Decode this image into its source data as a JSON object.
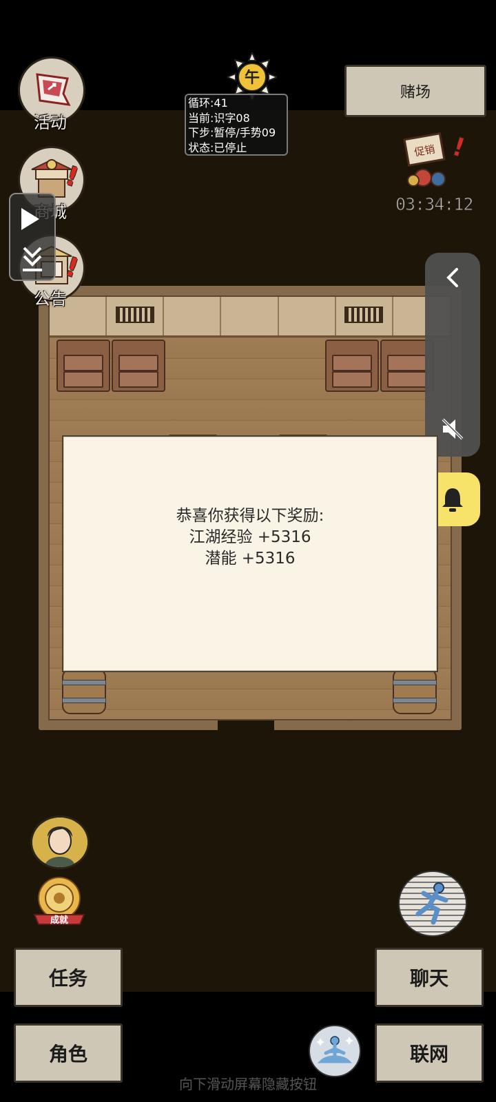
{
  "hud": {
    "event_label": "活动",
    "shop_label": "商城",
    "notice_label": "公告",
    "casino_button": "赌场",
    "time_of_day": "午",
    "promo_sign": "促销",
    "countdown": "03:34:12"
  },
  "status_overlay": {
    "loop": "循环:41",
    "current": "当前:识字08",
    "next": "下步:暂停/手势09",
    "state": "状态:已停止"
  },
  "reward_dialog": {
    "line1": "恭喜你获得以下奖励:",
    "line2": "江湖经验 +5316",
    "line3": "潜能 +5316"
  },
  "achievement_label": "成就",
  "bottom_menu": {
    "tasks": "任务",
    "character": "角色",
    "chat": "聊天",
    "network": "联网"
  },
  "hint_text": "向下滑动屏幕隐藏按钮",
  "colors": {
    "background": "#1d1608",
    "button_face": "#cfc7b6",
    "dialog": "#faf4e6",
    "bell": "#f8e36a",
    "alert": "#d42a20"
  }
}
